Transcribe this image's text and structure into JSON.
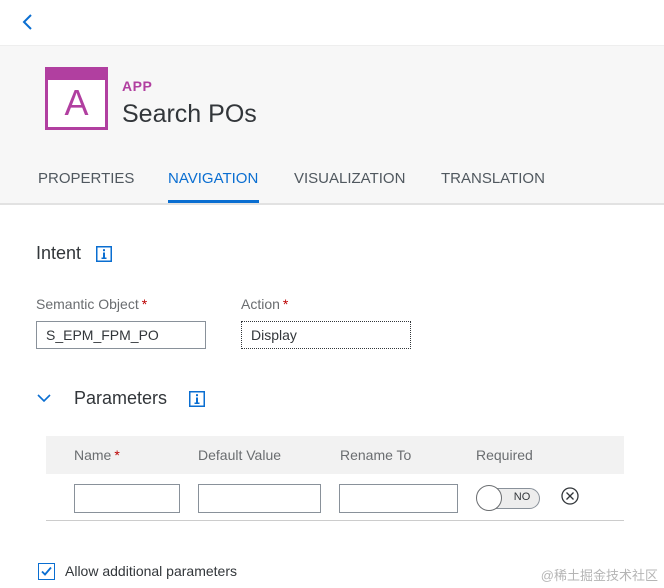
{
  "app": {
    "type_label": "APP",
    "title": "Search POs",
    "tile_letter": "A",
    "brand_color": "#b13fa0"
  },
  "nav": {
    "back_icon": "chevron-left-icon"
  },
  "tabs": [
    {
      "label": "PROPERTIES",
      "active": false
    },
    {
      "label": "NAVIGATION",
      "active": true
    },
    {
      "label": "VISUALIZATION",
      "active": false
    },
    {
      "label": "TRANSLATION",
      "active": false
    }
  ],
  "intent": {
    "title": "Intent",
    "info_icon": "info-icon",
    "semantic_object": {
      "label": "Semantic Object",
      "required_mark": "*",
      "value": "S_EPM_FPM_PO"
    },
    "action": {
      "label": "Action",
      "required_mark": "*",
      "value": "Display"
    }
  },
  "parameters": {
    "title": "Parameters",
    "expanded": true,
    "columns": [
      {
        "label": "Name",
        "required_mark": "*"
      },
      {
        "label": "Default Value",
        "required_mark": ""
      },
      {
        "label": "Rename To",
        "required_mark": ""
      },
      {
        "label": "Required",
        "required_mark": ""
      }
    ],
    "rows": [
      {
        "name": "",
        "default_value": "",
        "rename_to": "",
        "required": "NO"
      }
    ]
  },
  "allow_additional": {
    "label": "Allow additional parameters",
    "checked": true
  },
  "watermark": "@稀土掘金技术社区",
  "colors": {
    "accent": "#0a6ed1",
    "required": "#bb0000",
    "text": "#32363a"
  }
}
